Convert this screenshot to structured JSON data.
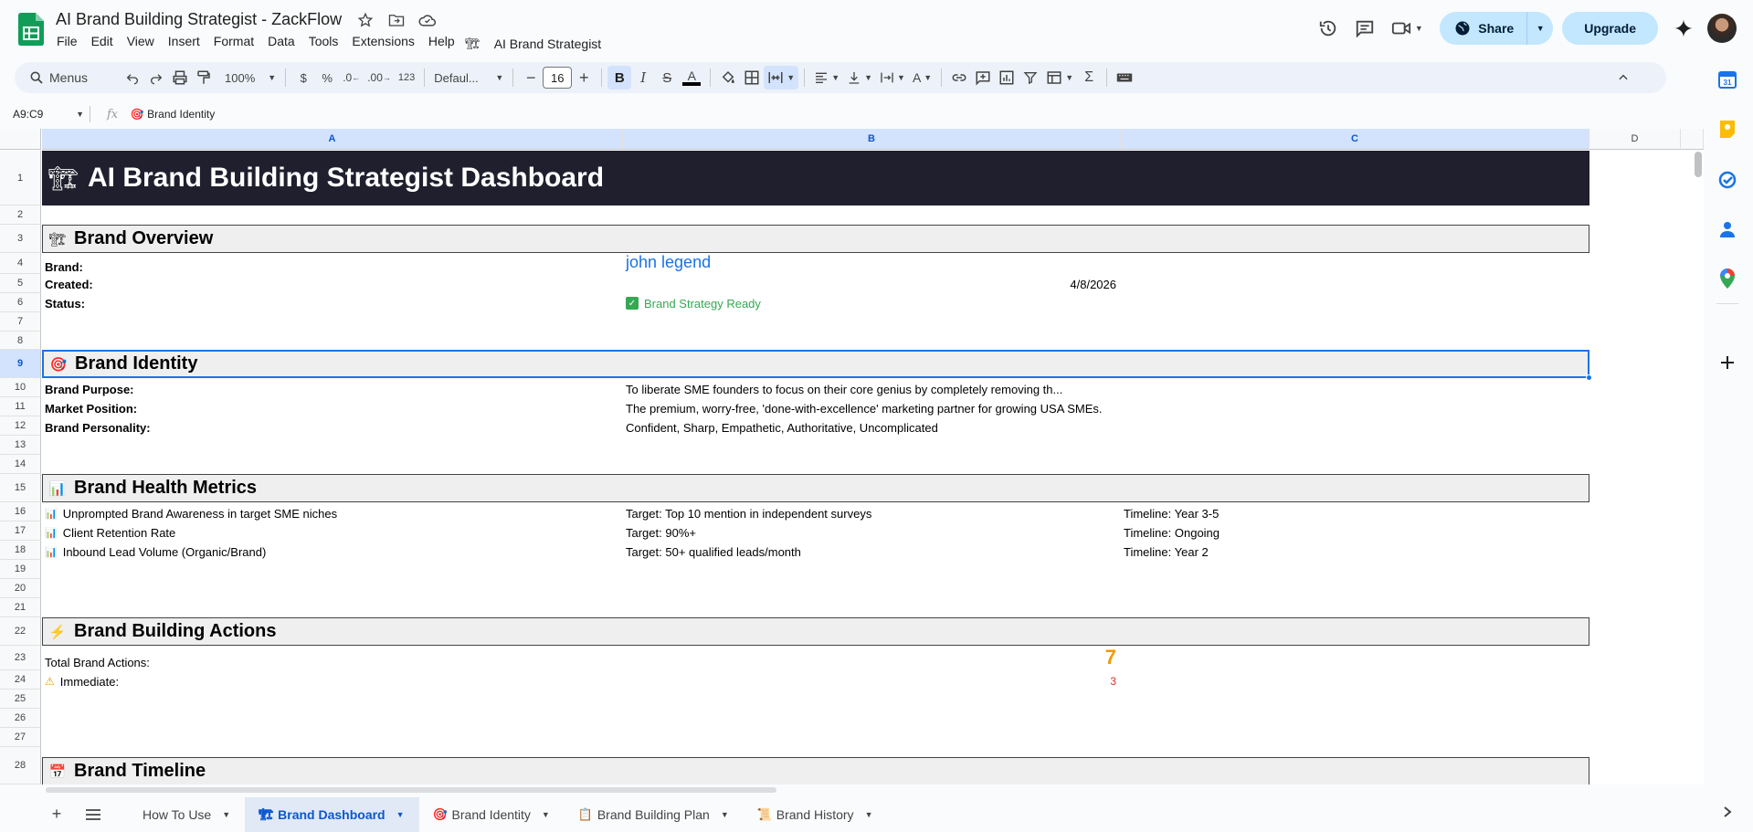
{
  "header": {
    "doc_title": "AI Brand Building Strategist - ZackFlow",
    "menus": [
      "File",
      "Edit",
      "View",
      "Insert",
      "Format",
      "Data",
      "Tools",
      "Extensions",
      "Help"
    ],
    "addon_menu": "AI Brand Strategist",
    "share_label": "Share",
    "upgrade_label": "Upgrade"
  },
  "toolbar": {
    "menus_label": "Menus",
    "zoom": "100%",
    "currency": "$",
    "percent": "%",
    "dec_decrease": ".0",
    "dec_increase": ".00",
    "number_format": "123",
    "font": "Defaul...",
    "font_size": "16",
    "bold": "B",
    "italic": "I",
    "strike": "S",
    "textcolor": "A"
  },
  "formula_bar": {
    "name_box": "A9:C9",
    "fx": "fx",
    "content": "Brand Identity"
  },
  "columns": [
    "A",
    "B",
    "C",
    "D"
  ],
  "rows": [
    "1",
    "2",
    "3",
    "4",
    "5",
    "6",
    "7",
    "8",
    "9",
    "10",
    "11",
    "12",
    "13",
    "14",
    "15",
    "16",
    "17",
    "18",
    "19",
    "20",
    "21",
    "22",
    "23",
    "24",
    "25",
    "26",
    "27",
    "28"
  ],
  "sheet": {
    "banner": "AI Brand Building Strategist Dashboard",
    "overview": {
      "title": "Brand Overview",
      "brand_label": "Brand:",
      "brand_value": "john legend",
      "created_label": "Created:",
      "created_value": "4/8/2026",
      "status_label": "Status:",
      "status_value": "Brand Strategy Ready"
    },
    "identity": {
      "title": "Brand Identity",
      "purpose_label": "Brand Purpose:",
      "purpose_value": "To liberate SME founders to focus on their core genius by completely removing th...",
      "position_label": "Market Position:",
      "position_value": "The premium, worry-free, 'done-with-excellence' marketing partner for growing USA SMEs.",
      "personality_label": "Brand Personality:",
      "personality_value": "Confident, Sharp, Empathetic, Authoritative, Uncomplicated"
    },
    "health": {
      "title": "Brand Health Metrics",
      "metrics": [
        {
          "name": "Unprompted Brand Awareness in target SME niches",
          "target": "Target: Top 10 mention in independent surveys",
          "timeline": "Timeline: Year 3-5"
        },
        {
          "name": "Client Retention Rate",
          "target": "Target: 90%+",
          "timeline": "Timeline: Ongoing"
        },
        {
          "name": "Inbound Lead Volume (Organic/Brand)",
          "target": "Target: 50+ qualified leads/month",
          "timeline": "Timeline: Year 2"
        }
      ]
    },
    "actions": {
      "title": "Brand Building Actions",
      "total_label": "Total Brand Actions:",
      "total_value": "7",
      "immediate_label": "Immediate:",
      "immediate_value": "3"
    },
    "timeline": {
      "title": "Brand Timeline"
    }
  },
  "tabs": [
    {
      "label": "How To Use"
    },
    {
      "label": "Brand Dashboard"
    },
    {
      "label": "Brand Identity"
    },
    {
      "label": "Brand Building Plan"
    },
    {
      "label": "Brand History"
    }
  ],
  "colors": {
    "banner_bg": "#1f1f2e",
    "brand_blue": "#1a73e8",
    "status_green": "#34a853",
    "total_orange": "#f29900",
    "immediate_red": "#d93025"
  }
}
